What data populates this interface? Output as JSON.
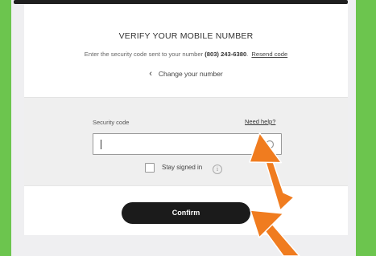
{
  "verify": {
    "heading": "VERIFY YOUR MOBILE NUMBER",
    "instructions_prefix": "Enter the security code sent to your number",
    "phone_number": "(803) 243-6380",
    "instructions_suffix": ".",
    "resend_label": "Resend code",
    "change_number_label": "Change your number"
  },
  "form": {
    "security_code_label": "Security code",
    "need_help_label": "Need help?",
    "security_code_value": "",
    "stay_signed_in_label": "Stay signed in",
    "stay_signed_in_checked": false
  },
  "actions": {
    "confirm_label": "Confirm"
  },
  "colors": {
    "background": "#6cc54e",
    "button": "#1b1b1b",
    "annotation_arrow": "#f07c1f"
  },
  "icons": {
    "back": "chevron-left-icon",
    "input_action": "circle-icon",
    "info": "info-icon",
    "annotations": "arrow-icon"
  }
}
